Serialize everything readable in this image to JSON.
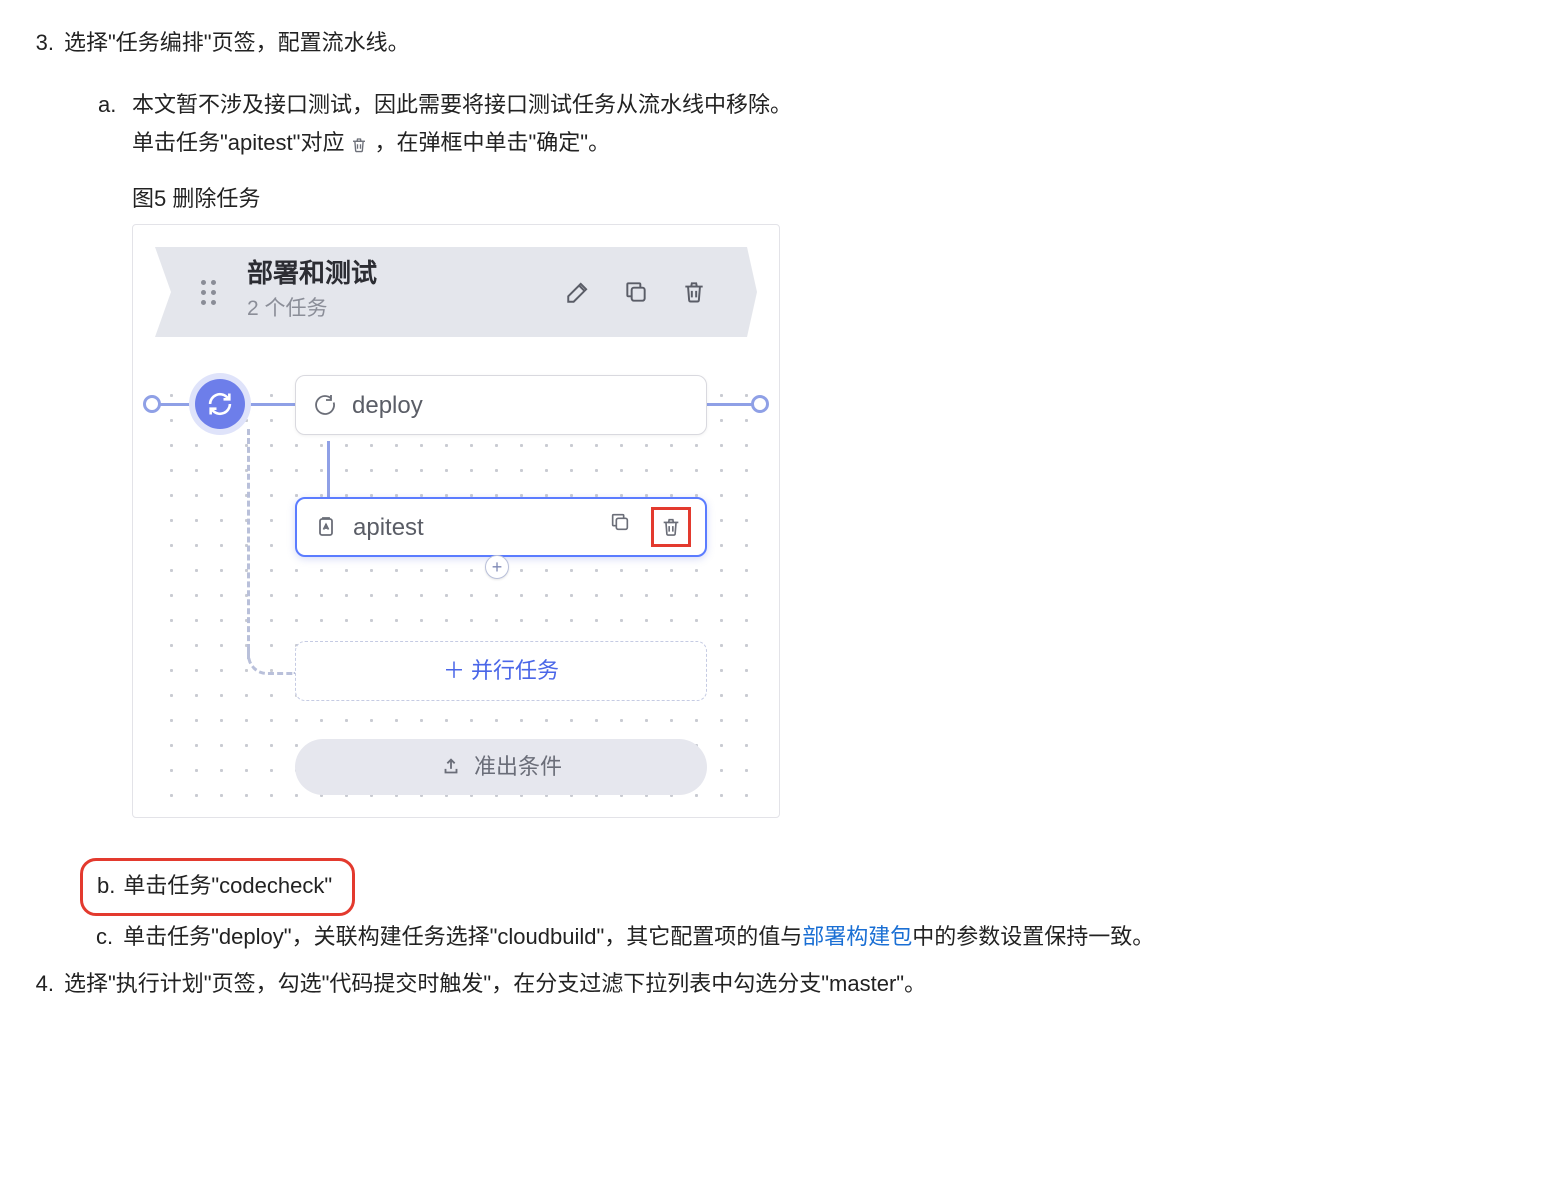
{
  "step3": {
    "number": "3.",
    "text": "选择\"任务编排\"页签，配置流水线。"
  },
  "sub_a": {
    "label": "a.",
    "line1": "本文暂不涉及接口测试，因此需要将接口测试任务从流水线中移除。",
    "line2_before": "单击任务\"apitest\"对应",
    "line2_after": "，在弹框中单击\"确定\"。",
    "caption": "图5 删除任务"
  },
  "card": {
    "stage_title": "部署和测试",
    "stage_sub": "2 个任务",
    "tasks": {
      "deploy": "deploy",
      "apitest": "apitest"
    },
    "parallel_label": "＋ 并行任务",
    "exit_cond_label": "准出条件"
  },
  "sub_b": {
    "label": "b.",
    "text": "单击任务\"codecheck\""
  },
  "sub_c": {
    "label": "c.",
    "before_link": "单击任务\"deploy\"，关联构建任务选择\"cloudbuild\"，其它配置项的值与",
    "link_text": "部署构建包",
    "after_link": "中的参数设置保持一致。"
  },
  "step4": {
    "number": "4.",
    "text": "选择\"执行计划\"页签，勾选\"代码提交时触发\"，在分支过滤下拉列表中勾选分支\"master\"。"
  }
}
